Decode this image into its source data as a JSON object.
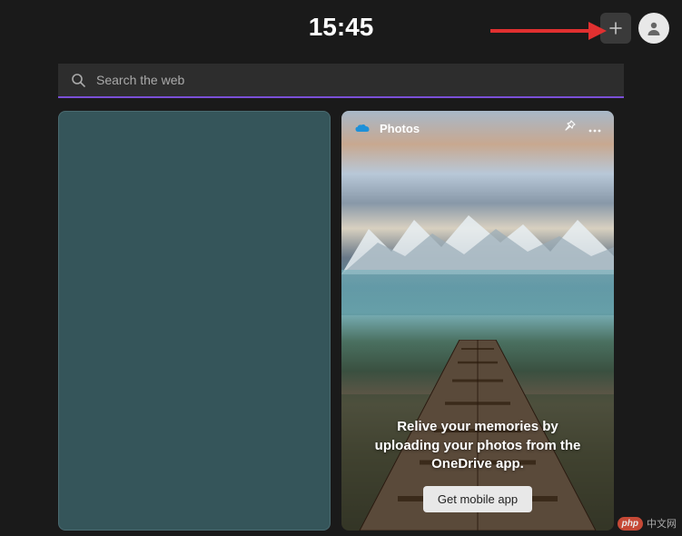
{
  "header": {
    "time": "15:45"
  },
  "search": {
    "placeholder": "Search the web"
  },
  "cards": {
    "photos": {
      "title": "Photos",
      "overlay_text": "Relive your memories by uploading your photos from the OneDrive app.",
      "button_label": "Get mobile app"
    }
  },
  "watermark": {
    "badge": "php",
    "text": "中文网"
  },
  "colors": {
    "accent": "#7a4fd6",
    "background": "#1a1a1a",
    "card_empty": "#35555a"
  }
}
